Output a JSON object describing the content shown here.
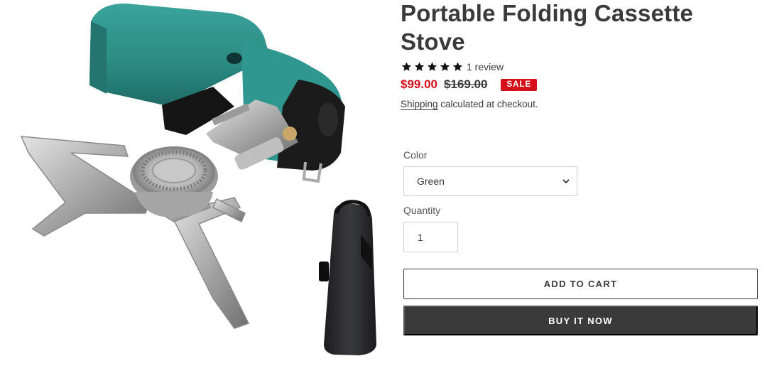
{
  "product": {
    "title": "Portable Folding Cassette Stove",
    "rating_stars": 5,
    "review_count": "1 review",
    "sale_price": "$99.00",
    "compare_price": "$169.00",
    "sale_badge": "SALE",
    "shipping_link": "Shipping",
    "shipping_text": " calculated at checkout.",
    "image_alt": "Portable folding cassette stove with carry bag"
  },
  "options": {
    "color_label": "Color",
    "color_value": "Green",
    "quantity_label": "Quantity",
    "quantity_value": "1"
  },
  "actions": {
    "add_to_cart": "ADD TO CART",
    "buy_now": "BUY IT NOW"
  },
  "colors": {
    "sale_red": "#d6101a",
    "text_dark": "#3a3a3a",
    "stove_teal": "#2c8c86"
  }
}
